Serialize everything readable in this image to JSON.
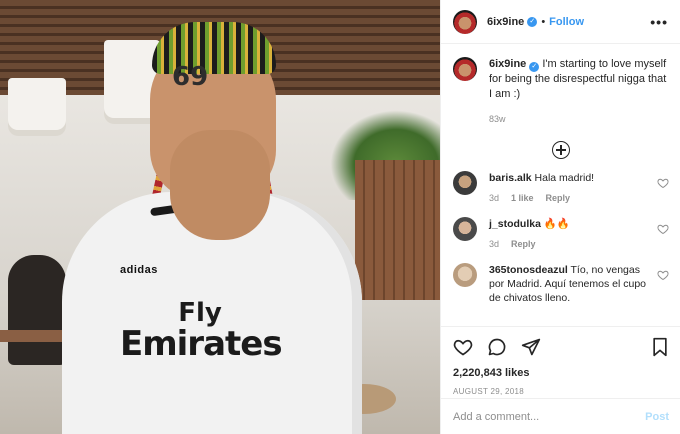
{
  "colors": {
    "accent": "#3897f0",
    "text": "#262626",
    "muted": "#8e8e8e",
    "post_disabled": "#b2dffc"
  },
  "photo": {
    "jersey_line1": "Fly",
    "jersey_line2": "Emirates",
    "jersey_brand": "adidas",
    "face_tattoo": "69"
  },
  "header": {
    "username": "6ix9ine",
    "follow_label": "Follow",
    "more_label": "•••"
  },
  "caption": {
    "username": "6ix9ine",
    "text": "I'm starting to love myself for being the disrespectful nigga that I am :)",
    "time": "83w"
  },
  "comments": [
    {
      "username": "baris.alk",
      "text": "Hala madrid!",
      "time": "3d",
      "likes": "1 like",
      "reply": "Reply"
    },
    {
      "username": "j_stodulka",
      "text": "🔥🔥",
      "time": "3d",
      "likes": "",
      "reply": "Reply"
    },
    {
      "username": "365tonosdeazul",
      "text": "Tío, no vengas por Madrid. Aquí tenemos el cupo de chivatos lleno.",
      "time": "",
      "likes": "",
      "reply": ""
    }
  ],
  "actions": {
    "likes": "2,220,843 likes",
    "date": "AUGUST 29, 2018"
  },
  "add_comment": {
    "placeholder": "Add a comment...",
    "post_label": "Post"
  },
  "icons": {
    "like": "heart-icon",
    "comment": "comment-icon",
    "share": "share-icon",
    "save": "bookmark-icon",
    "verified": "verified-badge-icon",
    "load_more": "plus-circle-icon"
  }
}
